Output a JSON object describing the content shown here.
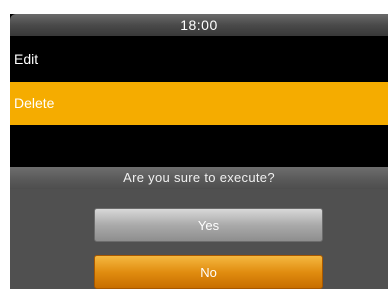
{
  "status_bar": {
    "time": "18:00"
  },
  "menu": {
    "items": [
      {
        "label": "Edit"
      },
      {
        "label": "Delete"
      }
    ]
  },
  "dialog": {
    "message": "Are you sure to execute?",
    "yes_label": "Yes",
    "no_label": "No"
  },
  "colors": {
    "highlight": "#f5ac00",
    "dialog_bg": "#505050",
    "no_button": "#e18d10",
    "yes_button": "#aaaaaa"
  }
}
